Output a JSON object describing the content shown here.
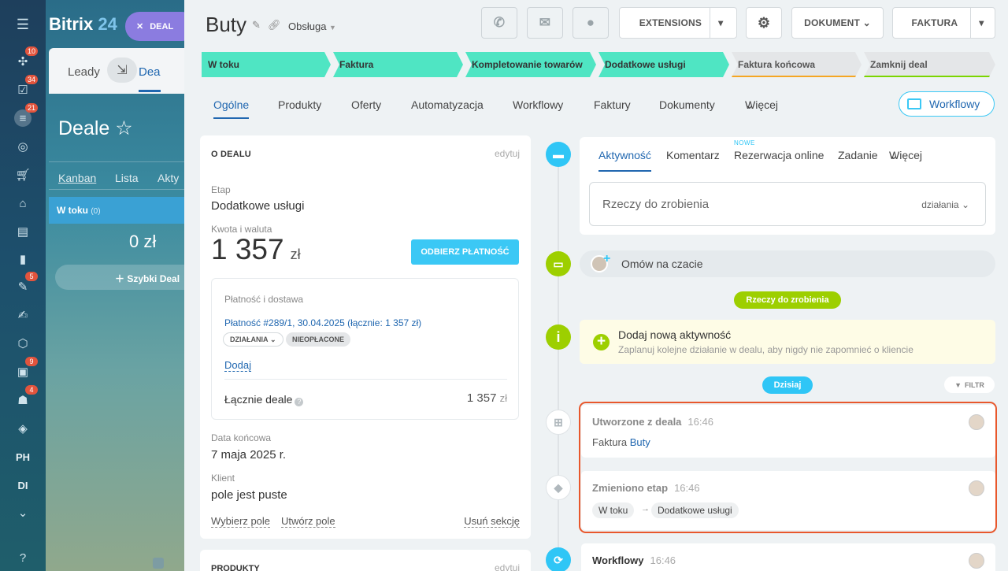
{
  "sidebar": {
    "menu_icon": "menu-icon",
    "items": [
      {
        "icon": "feed-icon",
        "badge": "10"
      },
      {
        "icon": "tasks-icon",
        "badge": "34"
      },
      {
        "icon": "crm-icon",
        "badge": "21"
      },
      {
        "icon": "target-icon",
        "badge": ""
      },
      {
        "icon": "shop-icon",
        "badge": ""
      },
      {
        "icon": "bank-icon",
        "badge": ""
      },
      {
        "icon": "documents-icon",
        "badge": ""
      },
      {
        "icon": "analytics-icon",
        "badge": ""
      },
      {
        "icon": "sign-icon",
        "badge": "5"
      },
      {
        "icon": "signature-icon",
        "badge": ""
      },
      {
        "icon": "shield-icon",
        "badge": ""
      },
      {
        "icon": "contacts-icon",
        "badge": "9"
      },
      {
        "icon": "bot-icon",
        "badge": "4"
      },
      {
        "icon": "box-icon",
        "badge": ""
      }
    ],
    "text_items": [
      "PH",
      "DI"
    ],
    "help_icon": "help-icon"
  },
  "background": {
    "brand_name": "Bitrix",
    "brand_num": "24",
    "deal_pill": "DEAL",
    "tab_leads": "Leady",
    "tab_deals": "Dea",
    "title": "Deale",
    "views": [
      "Kanban",
      "Lista",
      "Akty"
    ],
    "column_name": "W toku",
    "column_count": "(0)",
    "column_sum": "0 zł",
    "quick_deal": "Szybki Deal"
  },
  "header": {
    "title": "Buty",
    "pipeline": "Obsługa",
    "extensions": "EXTENSIONS",
    "document": "DOKUMENT",
    "invoice": "FAKTURA"
  },
  "stages": [
    {
      "label": "W toku",
      "done": true,
      "bar": ""
    },
    {
      "label": "Faktura",
      "done": true,
      "bar": ""
    },
    {
      "label": "Kompletowanie towarów",
      "done": true,
      "bar": ""
    },
    {
      "label": "Dodatkowe usługi",
      "done": true,
      "bar": ""
    },
    {
      "label": "Faktura końcowa",
      "done": false,
      "bar": "#f5a623"
    },
    {
      "label": "Zamknij deal",
      "done": false,
      "bar": "#7bd500"
    }
  ],
  "tabs": [
    "Ogólne",
    "Produkty",
    "Oferty",
    "Automatyzacja",
    "Workflowy",
    "Faktury",
    "Dokumenty",
    "Więcej"
  ],
  "workflow_button": "Workflowy",
  "deal_card": {
    "title": "O DEALU",
    "edit": "edytuj",
    "stage_label": "Etap",
    "stage_value": "Dodatkowe usługi",
    "amount_label": "Kwota i waluta",
    "amount": "1 357",
    "currency": "zł",
    "pay_button": "ODBIERZ PŁATNOŚĆ",
    "payment_section": "Płatność i dostawa",
    "payment_link": "Płatność #289/1, 30.04.2025 (łącznie: 1 357 zł)",
    "chip_actions": "DZIAŁANIA",
    "chip_unpaid": "NIEOPŁACONE",
    "add_link": "Dodaj",
    "total_label": "Łącznie deale",
    "total_value": "1 357",
    "total_currency": "zł",
    "close_label": "Data końcowa",
    "close_value": "7 maja 2025 r.",
    "client_label": "Klient",
    "client_value": "pole jest puste",
    "select_field": "Wybierz pole",
    "create_field": "Utwórz pole",
    "remove_section": "Usuń sekcję"
  },
  "products_card": {
    "title": "PRODUKTY",
    "edit": "edytuj"
  },
  "composer": {
    "tabs": [
      "Aktywność",
      "Komentarz",
      "Rezerwacja online",
      "Zadanie",
      "Więcej"
    ],
    "new_badge": "NOWE",
    "placeholder": "Rzeczy do zrobienia",
    "actions": "działania"
  },
  "discuss": "Omów na czacie",
  "todo_pill": "Rzeczy do zrobienia",
  "add_activity": {
    "title": "Dodaj nową aktywność",
    "subtitle": "Zaplanuj kolejne działanie w dealu, aby nigdy nie zapomnieć o kliencie"
  },
  "today_pill": "Dzisiaj",
  "filter": "FILTR",
  "events": [
    {
      "title": "Utworzone z deala",
      "time": "16:46",
      "prefix": "Faktura",
      "link": "Buty"
    },
    {
      "title": "Zmieniono etap",
      "time": "16:46",
      "from": "W toku",
      "to": "Dodatkowe usługi"
    },
    {
      "title": "Workflowy",
      "time": "16:46"
    }
  ],
  "colors": {
    "accent": "#2fc6f6",
    "stage_done": "#4fe5c3",
    "highlight": "#e8572c",
    "green": "#9dcf00"
  }
}
